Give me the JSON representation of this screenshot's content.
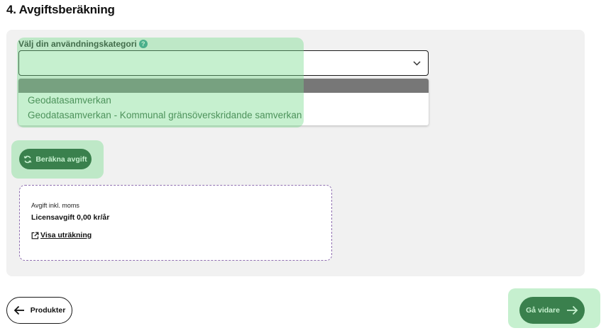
{
  "section": {
    "title": "4. Avgiftsberäkning"
  },
  "category_field": {
    "label": "Välj din användningskategori",
    "help_icon": "question-circle-icon",
    "selected_value": "",
    "options": [
      "",
      "Geodatasamverkan",
      "Geodatasamverkan - Kommunal gränsöverskridande samverkan"
    ]
  },
  "calculate_button": {
    "label": "Beräkna avgift",
    "icon": "refresh-icon"
  },
  "fee": {
    "caption": "Avgift inkl. moms",
    "value": "Licensavgift 0,00 kr/år",
    "details_link": "Visa uträkning",
    "details_icon": "external-link-icon"
  },
  "navigation": {
    "back_label": "Produkter",
    "back_icon": "arrow-left-icon",
    "next_label": "Gå vidare",
    "next_icon": "arrow-right-icon"
  },
  "colors": {
    "primary": "#0f3f1f",
    "card_background": "#f1f1f1",
    "highlight": "#78dc8c",
    "option_text": "#2d5d36",
    "fee_border": "#8f6fb0"
  }
}
